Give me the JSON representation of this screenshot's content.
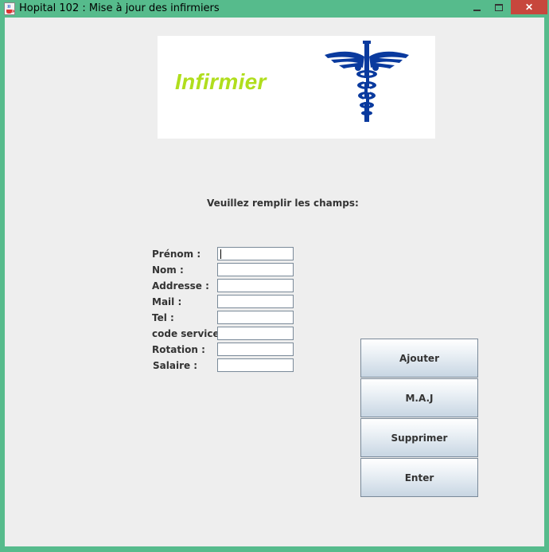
{
  "window": {
    "title": "Hopital 102 : Mise à jour des infirmiers",
    "app_icon": "java-cup-icon",
    "controls": {
      "minimize": "minimize-icon",
      "maximize": "maximize-icon",
      "close": "✕"
    }
  },
  "banner": {
    "title": "Infirmier",
    "image": "caduceus-icon",
    "title_color": "#b0de1d",
    "image_color": "#0a3a9e"
  },
  "form": {
    "instruction": "Veuillez remplir les champs:",
    "fields": [
      {
        "label": "Prénom :",
        "value": ""
      },
      {
        "label": "Nom :",
        "value": ""
      },
      {
        "label": "Addresse :",
        "value": ""
      },
      {
        "label": "Mail :",
        "value": ""
      },
      {
        "label": "Tel :",
        "value": ""
      },
      {
        "label": "code service :",
        "value": ""
      },
      {
        "label": "Rotation :",
        "value": ""
      },
      {
        "label": "Salaire :",
        "value": ""
      }
    ]
  },
  "actions": {
    "add": "Ajouter",
    "update": "M.A.J",
    "delete": "Supprimer",
    "enter": "Enter"
  },
  "colors": {
    "frame": "#56bb8c",
    "background": "#eeeeee",
    "close_button": "#c7473d"
  }
}
